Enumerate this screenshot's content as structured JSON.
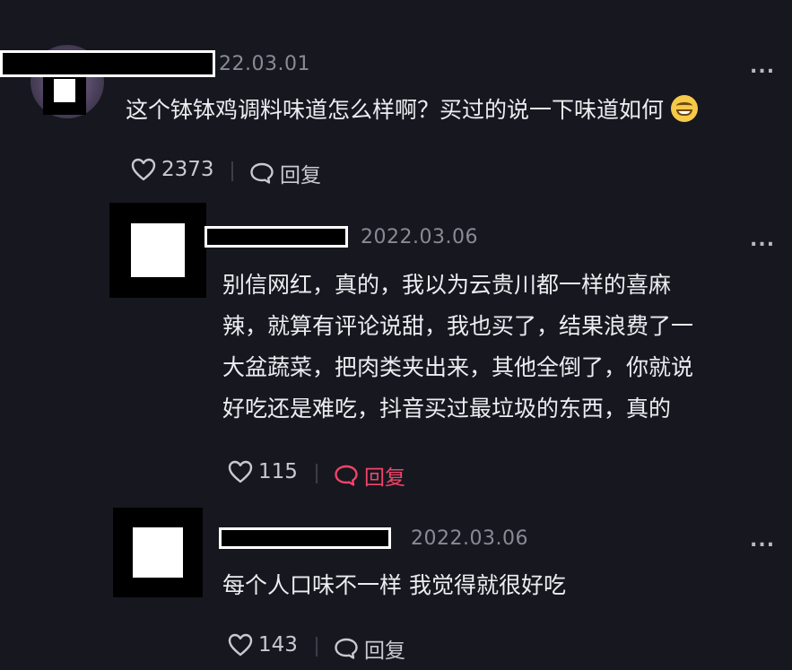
{
  "comments": [
    {
      "date": "22.03.01",
      "text_lines": [
        "这个钵钵鸡调料味道怎么样啊？买过的说一下味道如何"
      ],
      "emoji": "grinning-face-emoji",
      "likes": "2373",
      "reply_label": "回复",
      "more_label": "..."
    },
    {
      "date": "2022.03.06",
      "text_lines": [
        "别信网红，真的，我以为云贵川都一样的喜麻",
        "辣，就算有评论说甜，我也买了，结果浪费了一",
        "大盆蔬菜，把肉类夹出来，其他全倒了，你就说",
        "好吃还是难吃，抖音买过最垃圾的东西，真的"
      ],
      "likes": "115",
      "reply_label": "回复",
      "reply_active": true,
      "more_label": "..."
    },
    {
      "date": "2022.03.06",
      "text_lines": [
        "每个人口味不一样 我觉得就很好吃"
      ],
      "likes": "143",
      "reply_label": "回复",
      "more_label": "..."
    }
  ],
  "colors": {
    "background": "#17171f",
    "text": "#ececf1",
    "meta": "#8a8a94",
    "reply_active": "#f0456a"
  }
}
